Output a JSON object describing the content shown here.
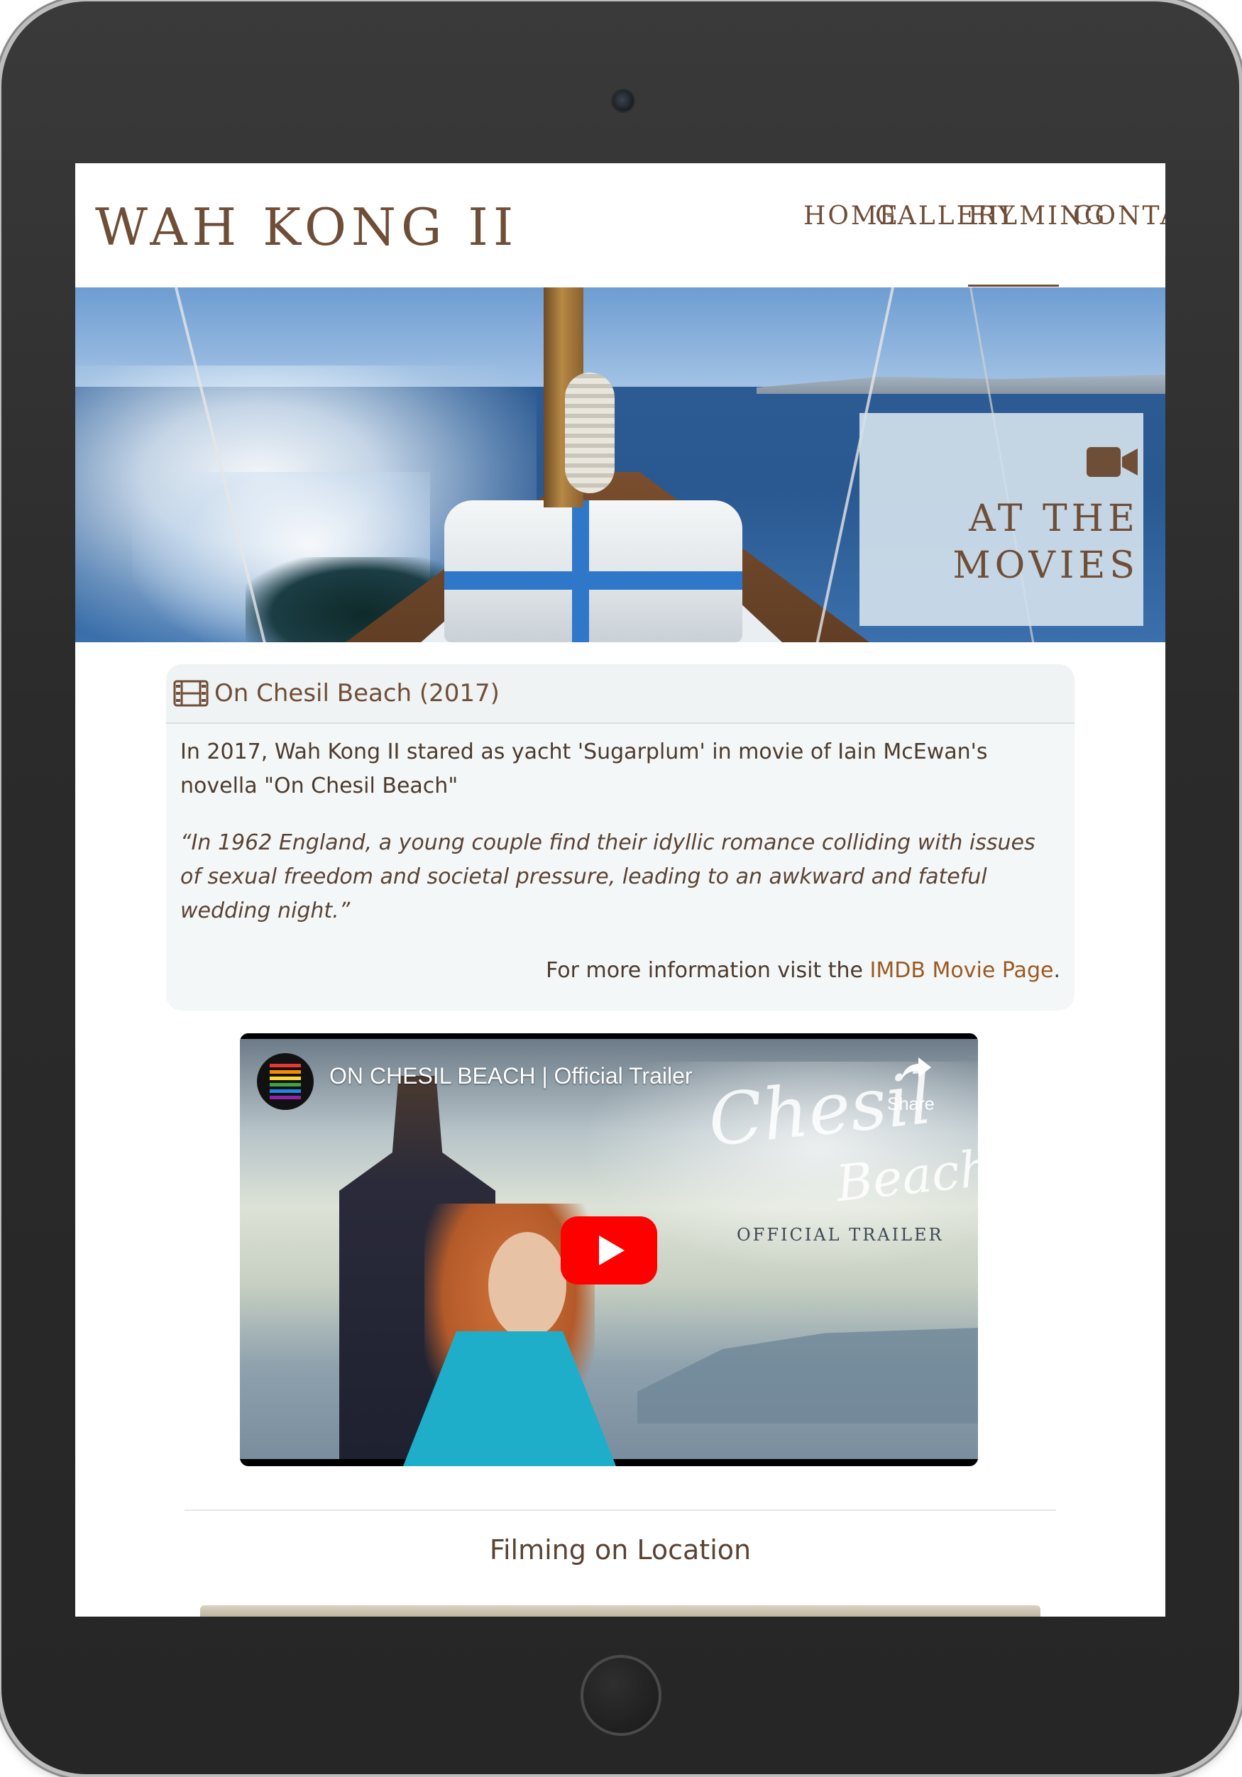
{
  "site": {
    "title": "WAH KONG II"
  },
  "nav": {
    "items": [
      {
        "label": "HOME",
        "active": false
      },
      {
        "label": "GALLERY",
        "active": false
      },
      {
        "label": "FILMING",
        "active": true
      },
      {
        "label": "CONTACT",
        "active": false
      }
    ]
  },
  "hero": {
    "icon": "video-camera-icon",
    "caption_line1": "AT THE",
    "caption_line2": "MOVIES"
  },
  "film_card": {
    "icon": "film-icon",
    "title": "On Chesil Beach (2017)",
    "intro": "In 2017, Wah Kong II stared as yacht 'Sugarplum' in movie of Iain McEwan's novella \"On Chesil Beach\"",
    "quote": "“In 1962 England, a young couple find their idyllic romance colliding with issues of sexual freedom and societal pressure, leading to an awkward and fateful wedding night.”",
    "more_prefix": "For more information visit the ",
    "more_link": "IMDB Movie Page",
    "more_suffix": "."
  },
  "video": {
    "title": "ON CHESIL BEACH | Official Trailer",
    "share_label": "Share",
    "poster_script_1": "Chesil",
    "poster_script_2": "Beach",
    "poster_subtitle": "OFFICIAL TRAILER"
  },
  "section": {
    "title": "Filming on Location"
  },
  "colors": {
    "brand_brown": "#6f4e37",
    "link": "#9a5a22",
    "youtube_red": "#ff0000",
    "card_bg": "#f4f7f8",
    "hero_box": "#d1e0eb"
  }
}
